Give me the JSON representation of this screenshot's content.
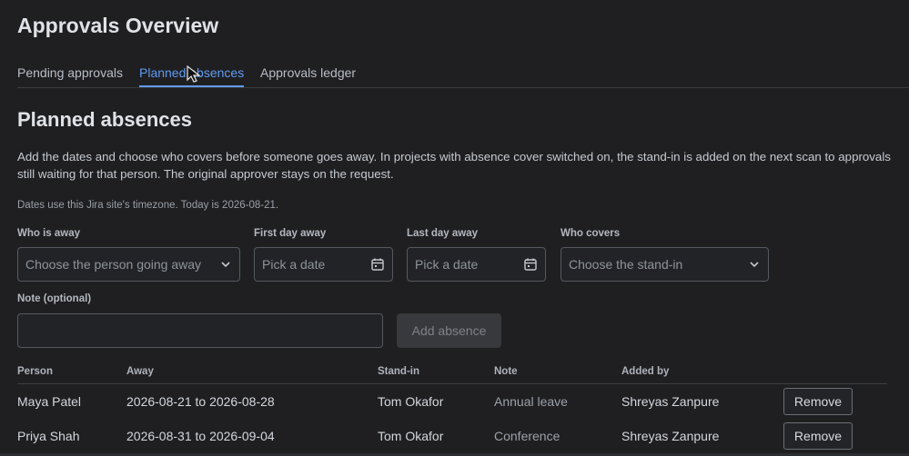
{
  "header": {
    "title": "Approvals Overview"
  },
  "tabs": [
    {
      "label": "Pending approvals"
    },
    {
      "label": "Planned absences",
      "active": true
    },
    {
      "label": "Approvals ledger"
    }
  ],
  "section": {
    "title": "Planned absences",
    "description": "Add the dates and choose who covers before someone goes away. In projects with absence cover switched on, the stand-in is added on the next scan to approvals still waiting for that person. The original approver stays on the request.",
    "timezone_note": "Dates use this Jira site's timezone. Today is 2026-08-21."
  },
  "form": {
    "who_away": {
      "label": "Who is away",
      "placeholder": "Choose the person going away"
    },
    "first_day": {
      "label": "First day away",
      "placeholder": "Pick a date"
    },
    "last_day": {
      "label": "Last day away",
      "placeholder": "Pick a date"
    },
    "who_covers": {
      "label": "Who covers",
      "placeholder": "Choose the stand-in"
    },
    "note": {
      "label": "Note (optional)",
      "value": ""
    },
    "add_button": "Add absence"
  },
  "table": {
    "headers": [
      "Person",
      "Away",
      "Stand-in",
      "Note",
      "Added by"
    ],
    "rows": [
      {
        "person": "Maya Patel",
        "away": "2026-08-21 to 2026-08-28",
        "standin": "Tom Okafor",
        "note": "Annual leave",
        "added_by": "Shreyas Zanpure",
        "action": "Remove"
      },
      {
        "person": "Priya Shah",
        "away": "2026-08-31 to 2026-09-04",
        "standin": "Tom Okafor",
        "note": "Conference",
        "added_by": "Shreyas Zanpure",
        "action": "Remove"
      }
    ]
  },
  "colors": {
    "accent": "#5f9bf0",
    "background": "#1f1f21"
  },
  "icons": {
    "dropdown": "chevron-down-icon",
    "date": "calendar-icon",
    "cursor": "mouse-pointer-icon"
  }
}
